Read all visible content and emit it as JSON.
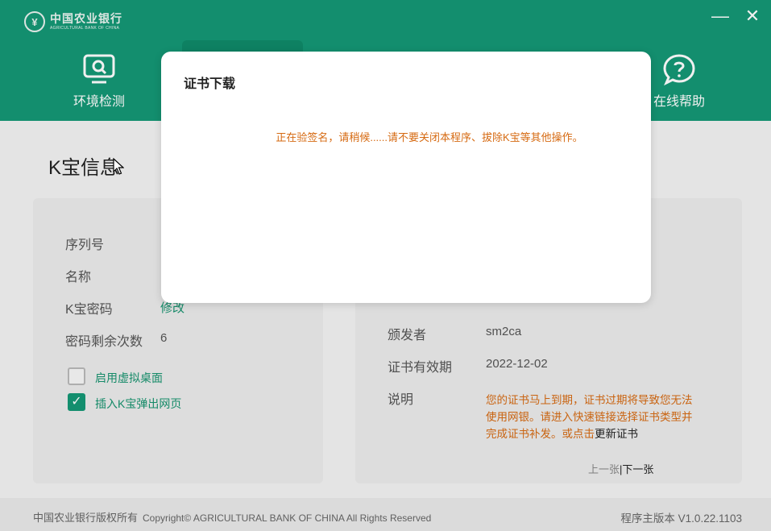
{
  "window": {
    "logo_cn": "中国农业银行",
    "logo_en": "AGRICULTURAL BANK OF CHINA",
    "minimize": "—",
    "close": "✕"
  },
  "nav": {
    "env_label": "环境检测",
    "help_label": "在线帮助"
  },
  "section": {
    "title": "K宝信息"
  },
  "left_card": {
    "serial_label": "序列号",
    "name_label": "名称",
    "password_label": "K宝密码",
    "password_link": "修改",
    "remaining_label": "密码剩余次数",
    "remaining_value": "6",
    "virtual_desktop_label": "启用虚拟桌面",
    "virtual_desktop_checked": false,
    "popup_label": "插入K宝弹出网页",
    "popup_checked": true
  },
  "right_card": {
    "issuer_label": "颁发者",
    "issuer_value": "sm2ca",
    "validity_label": "证书有效期",
    "validity_value": "2022-12-02",
    "desc_label": "说明",
    "desc_text": "您的证书马上到期，证书过期将导致您无法使用网银。请进入快速链接选择证书类型并完成证书补发。或点击",
    "desc_link": "更新证书",
    "prev": "上一张",
    "separator": "|",
    "next": "下一张"
  },
  "footer": {
    "bank_rights": "中国农业银行版权所有",
    "copyright": "Copyright© AGRICULTURAL BANK OF CHINA All Rights Reserved",
    "version": "程序主版本 V1.0.22.1103"
  },
  "modal": {
    "title": "证书下载",
    "message": "正在验签名，请稍候......请不要关闭本程序、拔除K宝等其他操作。"
  },
  "colors": {
    "brand_green": "#159775",
    "warning_orange": "#d66a12"
  }
}
